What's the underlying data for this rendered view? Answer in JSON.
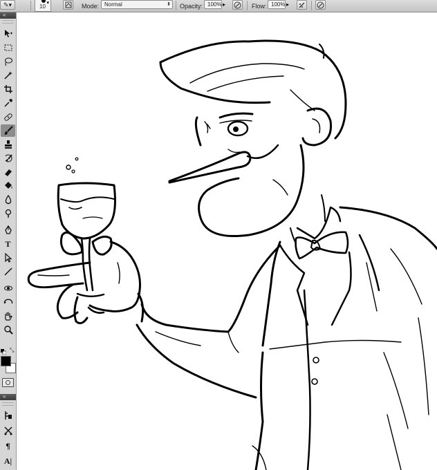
{
  "options_bar": {
    "brush_size": "10",
    "mode_label": "Mode:",
    "mode_value": "Normal",
    "opacity_label": "Opacity:",
    "opacity_value": "100%",
    "flow_label": "Flow:",
    "flow_value": "100%"
  },
  "tools_panel": {
    "header_glyph": "«",
    "tools": [
      "move-tool",
      "marquee-tool",
      "lasso-tool",
      "magic-wand-tool",
      "crop-tool",
      "eyedropper-tool",
      "healing-brush-tool",
      "brush-tool",
      "clone-stamp-tool",
      "history-brush-tool",
      "eraser-tool",
      "paint-bucket-tool",
      "blur-tool",
      "dodge-tool",
      "pen-tool",
      "type-tool",
      "path-selection-tool",
      "line-tool",
      "3d-rotate-tool",
      "3d-orbit-tool",
      "hand-tool",
      "zoom-tool"
    ],
    "active_tool": "brush-tool",
    "type_glyph": "T",
    "foreground_color": "#000000",
    "background_color": "#ffffff"
  },
  "secondary_panel": {
    "header_glyph": "«",
    "paragraph_glyph": "¶",
    "character_glyph": "A|"
  },
  "colors": {
    "toolbar_bg": "#d6d6d6",
    "active_tool_bg": "#8c8c8c",
    "canvas_bg": "#ffffff",
    "ink": "#000000"
  }
}
